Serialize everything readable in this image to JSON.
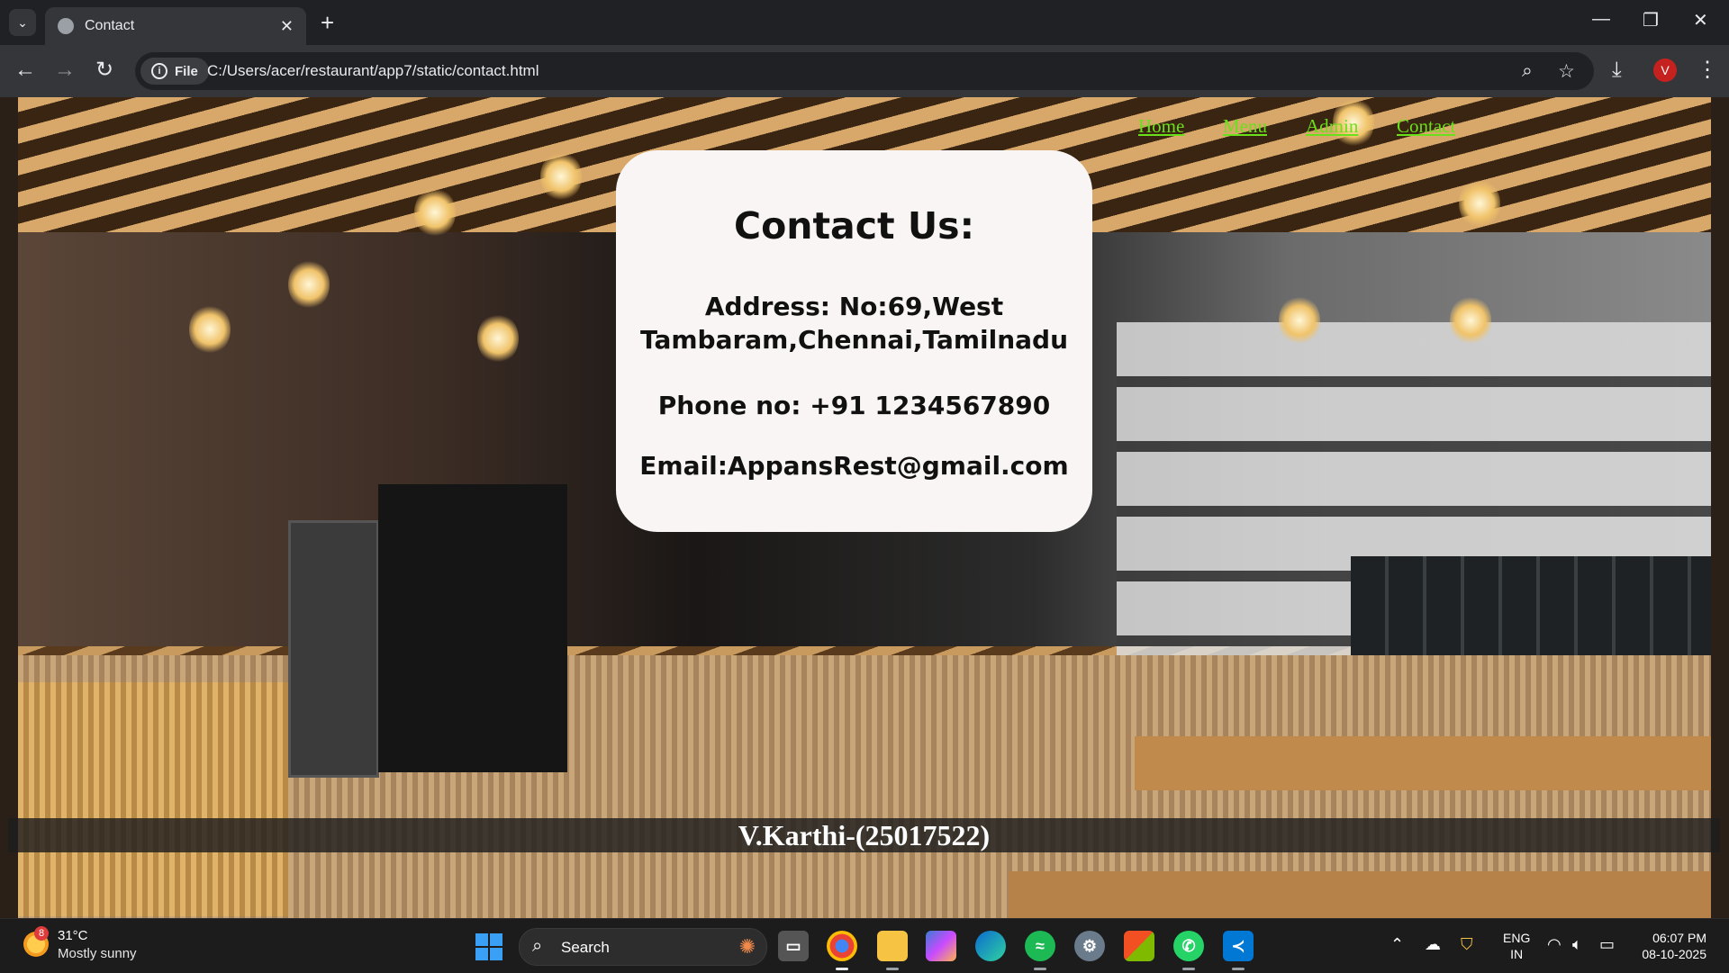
{
  "browser": {
    "tab_title": "Contact",
    "tab_close": "✕",
    "new_tab": "+",
    "minimize": "—",
    "restore": "❐",
    "close": "✕",
    "back": "←",
    "forward": "→",
    "reload": "↻",
    "file_chip": "File",
    "url": "C:/Users/acer/restaurant/app7/static/contact.html",
    "zoom": "⌕",
    "bookmark": "☆",
    "download": "⤓",
    "avatar_letter": "V",
    "menu": "⋮"
  },
  "page": {
    "nav": [
      "Home",
      "Menu",
      "Admin",
      "Contact"
    ],
    "card": {
      "heading": "Contact Us:",
      "address_line1": "Address: No:69,West",
      "address_line2": "Tambaram,Chennai,Tamilnadu",
      "phone": "Phone no: +91 1234567890",
      "email": "Email:AppansRest@gmail.com"
    },
    "footer": "V.Karthi-(25017522)"
  },
  "taskbar": {
    "weather_badge": "8",
    "temperature": "31°C",
    "condition": "Mostly sunny",
    "search_label": "Search",
    "lang_top": "ENG",
    "lang_bottom": "IN",
    "time": "06:07 PM",
    "date": "08-10-2025"
  },
  "colors": {
    "nav_link": "#6ae01a",
    "card_bg": "#f9f5f4",
    "avatar": "#c5221f"
  }
}
